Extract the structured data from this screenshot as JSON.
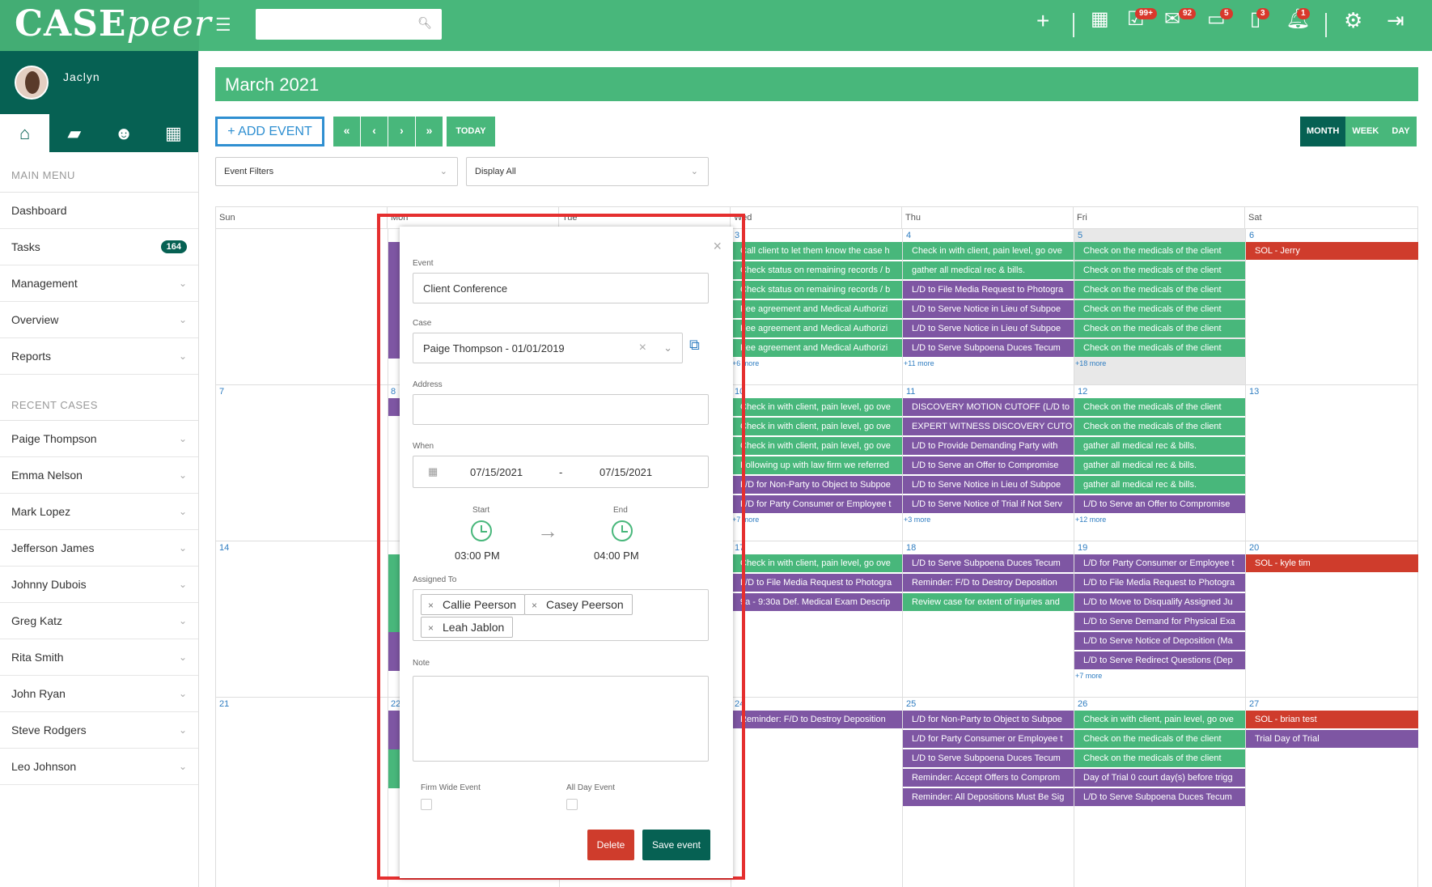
{
  "brand": {
    "logo_a": "CASE",
    "logo_b": "peer"
  },
  "topbar": {
    "badges": {
      "tasks": "99+",
      "mail": "92",
      "inbox": "5",
      "phone": "3",
      "bell": "1"
    }
  },
  "user": {
    "name": "Jaclyn"
  },
  "sidebar": {
    "main_menu": "MAIN MENU",
    "items": [
      "Dashboard",
      "Tasks",
      "Management",
      "Overview",
      "Reports"
    ],
    "tasks_count": "164",
    "recent": "RECENT CASES",
    "cases": [
      "Paige Thompson",
      "Emma Nelson",
      "Mark Lopez",
      "Jefferson James",
      "Johnny Dubois",
      "Greg Katz",
      "Rita Smith",
      "John Ryan",
      "Steve Rodgers",
      "Leo Johnson"
    ]
  },
  "calendar": {
    "title": "March 2021",
    "add": "+ ADD EVENT",
    "today": "TODAY",
    "views": [
      "MONTH",
      "WEEK",
      "DAY"
    ],
    "filter": "Event Filters",
    "display": "Display All",
    "days": [
      "Sun",
      "Mon",
      "Tue",
      "Wed",
      "Thu",
      "Fri",
      "Sat"
    ]
  },
  "colors": {
    "green": "#48b77b",
    "dark": "#066153",
    "purple": "#7e56a3",
    "red": "#cf3c2c"
  },
  "modal": {
    "event_label": "Event",
    "event": "Client Conference",
    "case_label": "Case",
    "case": "Paige Thompson - 01/01/2019",
    "address_label": "Address",
    "when_label": "When",
    "date_from": "07/15/2021",
    "dash": "-",
    "date_to": "07/15/2021",
    "start_label": "Start",
    "start": "03:00 PM",
    "end_label": "End",
    "end": "04:00 PM",
    "assigned_label": "Assigned To",
    "assignees": [
      "Callie Peerson",
      "Casey Peerson",
      "Leah Jablon"
    ],
    "note_label": "Note",
    "firm_wide": "Firm Wide Event",
    "all_day": "All Day Event",
    "delete": "Delete",
    "save": "Save event"
  }
}
